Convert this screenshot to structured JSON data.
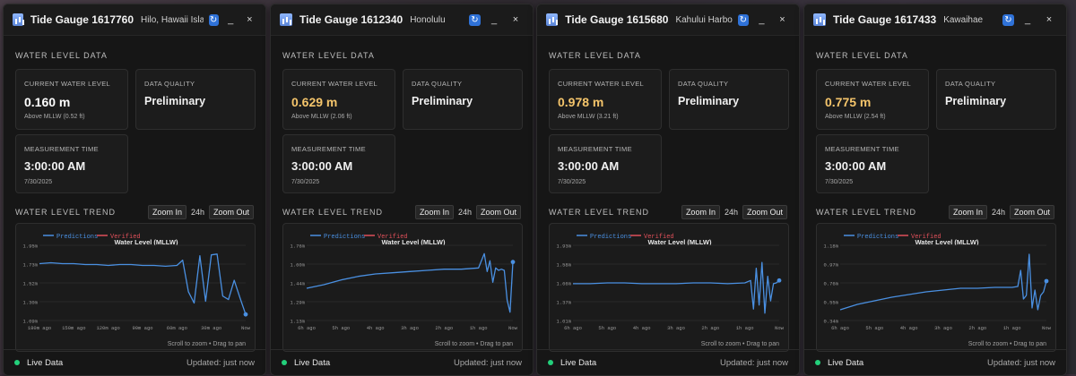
{
  "labels": {
    "water_level_data": "Water Level Data",
    "current_water_level": "Current Water Level",
    "data_quality": "Data Quality",
    "measurement_time": "Measurement Time",
    "water_level_trend": "Water Level Trend",
    "zoom_in": "Zoom In",
    "range": "24h",
    "zoom_out": "Zoom Out",
    "live_data": "Live Data",
    "updated": "Updated: just now",
    "hint": "Scroll to zoom • Drag to pan",
    "legend_predictions": "Predictions",
    "legend_verified": "Verified",
    "chart_title": "Water Level (MLLW)",
    "minimize": "_",
    "close": "×",
    "refresh": "↻"
  },
  "colors": {
    "accent_blue": "#4a90e2",
    "verified_red": "#e0505a",
    "value_white": "#ffffff",
    "value_amber": "#f5c56b",
    "live_green": "#23d07b"
  },
  "panels": [
    {
      "title": "Tide Gauge 1617760",
      "location": "Hilo, Hawaii Island",
      "water_level": "0.160 m",
      "water_level_sub": "Above MLLW (0.52 ft)",
      "value_color": "#ffffff",
      "quality": "Preliminary",
      "time": "3:00:00 AM",
      "date": "7/30/2025",
      "chart_data": {
        "type": "line",
        "title": "Water Level (MLLW)",
        "y_ticks": [
          "1.95m",
          "1.73m",
          "1.52m",
          "1.30m",
          "1.09m"
        ],
        "ylim": [
          1.09,
          1.95
        ],
        "x_ticks": [
          "180m ago",
          "150m ago",
          "120m ago",
          "90m ago",
          "60m ago",
          "30m ago",
          "Now"
        ],
        "xlim": [
          -180,
          0
        ],
        "series": [
          {
            "name": "Predictions",
            "x": [
              -180,
              -170,
              -160,
              -150,
              -140,
              -130,
              -120,
              -110,
              -100,
              -90,
              -80,
              -70,
              -60,
              -55,
              -50,
              -45,
              -40,
              -35,
              -30,
              -25,
              -20,
              -15,
              -10,
              -5,
              0
            ],
            "y": [
              1.74,
              1.75,
              1.74,
              1.74,
              1.73,
              1.73,
              1.72,
              1.73,
              1.73,
              1.72,
              1.72,
              1.71,
              1.72,
              1.78,
              1.42,
              1.29,
              1.83,
              1.31,
              1.84,
              1.85,
              1.37,
              1.33,
              1.55,
              1.35,
              1.16
            ]
          }
        ]
      }
    },
    {
      "title": "Tide Gauge 1612340",
      "location": "Honolulu",
      "water_level": "0.629 m",
      "water_level_sub": "Above MLLW (2.06 ft)",
      "value_color": "#f5c56b",
      "quality": "Preliminary",
      "time": "3:00:00 AM",
      "date": "7/30/2025",
      "chart_data": {
        "type": "line",
        "title": "Water Level (MLLW)",
        "y_ticks": [
          "1.76m",
          "1.60m",
          "1.44m",
          "1.29m",
          "1.13m"
        ],
        "ylim": [
          1.13,
          1.76
        ],
        "x_ticks": [
          "6h ago",
          "5h ago",
          "4h ago",
          "3h ago",
          "2h ago",
          "1h ago",
          "Now"
        ],
        "xlim": [
          -360,
          0
        ],
        "series": [
          {
            "name": "Predictions",
            "x": [
              -360,
              -330,
              -300,
              -270,
              -240,
              -210,
              -180,
              -150,
              -120,
              -90,
              -60,
              -50,
              -45,
              -40,
              -35,
              -30,
              -25,
              -20,
              -15,
              -10,
              -5,
              0
            ],
            "y": [
              1.4,
              1.43,
              1.47,
              1.5,
              1.52,
              1.53,
              1.54,
              1.55,
              1.56,
              1.56,
              1.57,
              1.69,
              1.54,
              1.63,
              1.45,
              1.57,
              1.55,
              1.56,
              1.55,
              1.3,
              1.2,
              1.62
            ]
          }
        ]
      }
    },
    {
      "title": "Tide Gauge 1615680",
      "location": "Kahului Harbor",
      "water_level": "0.978 m",
      "water_level_sub": "Above MLLW (3.21 ft)",
      "value_color": "#f5c56b",
      "quality": "Preliminary",
      "time": "3:00:00 AM",
      "date": "7/30/2025",
      "chart_data": {
        "type": "line",
        "title": "Water Level (MLLW)",
        "y_ticks": [
          "1.93m",
          "1.58m",
          "1.66m",
          "1.37m",
          "1.01m"
        ],
        "ylim": [
          1.01,
          1.93
        ],
        "x_ticks": [
          "6h ago",
          "5h ago",
          "4h ago",
          "3h ago",
          "2h ago",
          "1h ago",
          "Now"
        ],
        "xlim": [
          -360,
          0
        ],
        "series": [
          {
            "name": "Predictions",
            "x": [
              -360,
              -330,
              -300,
              -270,
              -240,
              -210,
              -180,
              -150,
              -120,
              -90,
              -60,
              -50,
              -45,
              -40,
              -35,
              -30,
              -25,
              -20,
              -15,
              -10,
              -5,
              0
            ],
            "y": [
              1.46,
              1.46,
              1.47,
              1.47,
              1.46,
              1.46,
              1.46,
              1.47,
              1.47,
              1.46,
              1.47,
              1.5,
              1.15,
              1.65,
              1.2,
              1.72,
              1.1,
              1.55,
              1.25,
              1.46,
              1.47,
              1.5
            ]
          }
        ]
      }
    },
    {
      "title": "Tide Gauge 1617433",
      "location": "Kawaihae",
      "water_level": "0.775 m",
      "water_level_sub": "Above MLLW (2.54 ft)",
      "value_color": "#f5c56b",
      "quality": "Preliminary",
      "time": "3:00:00 AM",
      "date": "7/30/2025",
      "chart_data": {
        "type": "line",
        "title": "Water Level (MLLW)",
        "y_ticks": [
          "1.18m",
          "0.97m",
          "0.76m",
          "0.55m",
          "0.34m"
        ],
        "ylim": [
          0.34,
          1.18
        ],
        "x_ticks": [
          "6h ago",
          "5h ago",
          "4h ago",
          "3h ago",
          "2h ago",
          "1h ago",
          "Now"
        ],
        "xlim": [
          -360,
          0
        ],
        "series": [
          {
            "name": "Predictions",
            "x": [
              -360,
              -330,
              -300,
              -270,
              -240,
              -210,
              -180,
              -150,
              -120,
              -90,
              -60,
              -50,
              -45,
              -40,
              -35,
              -30,
              -25,
              -20,
              -15,
              -10,
              -5,
              0
            ],
            "y": [
              0.46,
              0.52,
              0.56,
              0.6,
              0.63,
              0.66,
              0.68,
              0.7,
              0.7,
              0.71,
              0.71,
              0.72,
              0.9,
              0.58,
              0.62,
              1.08,
              0.48,
              0.68,
              0.46,
              0.62,
              0.66,
              0.78
            ]
          }
        ]
      }
    }
  ]
}
